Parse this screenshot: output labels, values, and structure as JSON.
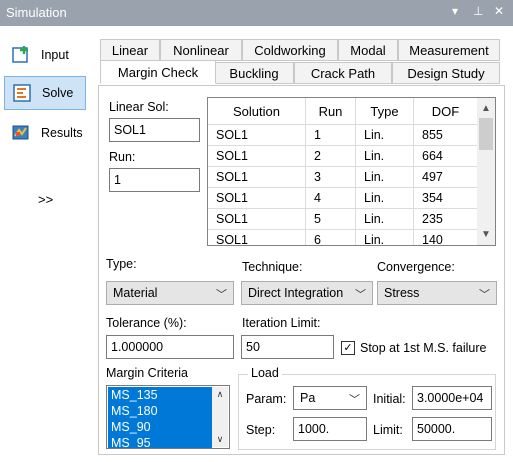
{
  "window": {
    "title": "Simulation",
    "controls": [
      "▾",
      "⊥",
      "✕"
    ]
  },
  "sidebar": {
    "items": [
      {
        "label": "Input",
        "icon": "input-icon"
      },
      {
        "label": "Solve",
        "icon": "solve-icon"
      },
      {
        "label": "Results",
        "icon": "results-icon"
      }
    ],
    "more": ">>"
  },
  "tabs": {
    "row1": [
      "Linear",
      "Nonlinear",
      "Coldworking",
      "Modal",
      "Measurement"
    ],
    "row2": [
      "Margin Check",
      "Buckling",
      "Crack Path",
      "Design Study"
    ],
    "active": "Margin Check"
  },
  "form": {
    "linear_sol_label": "Linear Sol:",
    "linear_sol_value": "SOL1",
    "run_label": "Run:",
    "run_value": "1",
    "type_label": "Type:",
    "type_value": "Material",
    "technique_label": "Technique:",
    "technique_value": "Direct Integration",
    "convergence_label": "Convergence:",
    "convergence_value": "Stress",
    "tolerance_label": "Tolerance (%):",
    "tolerance_value": "1.000000",
    "iteration_label": "Iteration Limit:",
    "iteration_value": "50",
    "stop_label": "Stop at 1st M.S. failure",
    "stop_checked": "✓",
    "margin_label": "Margin Criteria",
    "margin_items": [
      "MS_135",
      "MS_180",
      "MS_90",
      "MS_95"
    ]
  },
  "grid": {
    "columns": [
      "Solution",
      "Run",
      "Type",
      "DOF"
    ],
    "rows": [
      [
        "SOL1",
        "1",
        "Lin.",
        "855"
      ],
      [
        "SOL1",
        "2",
        "Lin.",
        "664"
      ],
      [
        "SOL1",
        "3",
        "Lin.",
        "497"
      ],
      [
        "SOL1",
        "4",
        "Lin.",
        "354"
      ],
      [
        "SOL1",
        "5",
        "Lin.",
        "235"
      ],
      [
        "SOL1",
        "6",
        "Lin.",
        "140"
      ]
    ]
  },
  "load": {
    "title": "Load",
    "param_label": "Param:",
    "param_value": "Pa",
    "initial_label": "Initial:",
    "initial_value": "3.0000e+04",
    "step_label": "Step:",
    "step_value": "1000.",
    "limit_label": "Limit:",
    "limit_value": "50000."
  }
}
